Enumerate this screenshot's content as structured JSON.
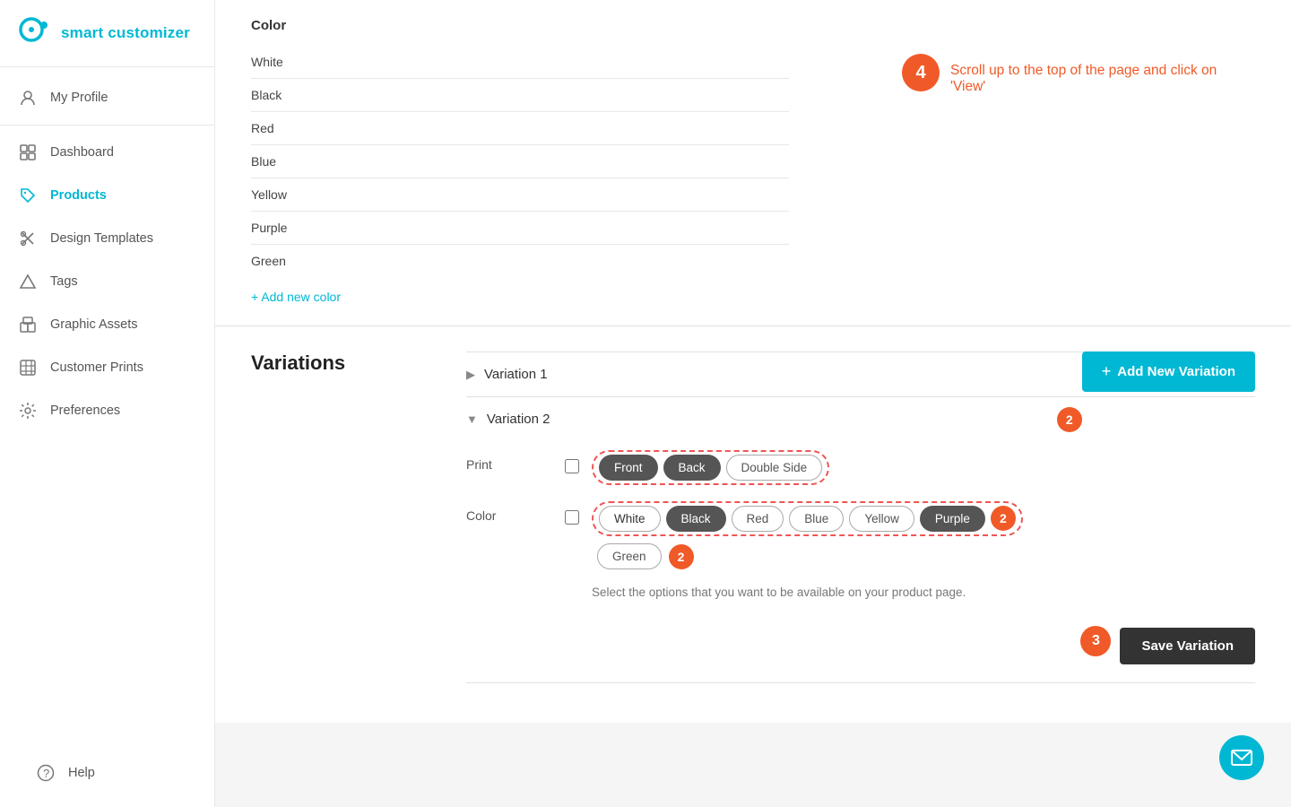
{
  "app": {
    "name": "smart customizer"
  },
  "sidebar": {
    "items": [
      {
        "id": "my-profile",
        "label": "My Profile",
        "icon": "person"
      },
      {
        "id": "dashboard",
        "label": "Dashboard",
        "icon": "grid"
      },
      {
        "id": "products",
        "label": "Products",
        "icon": "tag",
        "active": true
      },
      {
        "id": "design-templates",
        "label": "Design Templates",
        "icon": "scissors"
      },
      {
        "id": "tags",
        "label": "Tags",
        "icon": "triangle"
      },
      {
        "id": "graphic-assets",
        "label": "Graphic Assets",
        "icon": "boxes"
      },
      {
        "id": "customer-prints",
        "label": "Customer Prints",
        "icon": "grid2"
      },
      {
        "id": "preferences",
        "label": "Preferences",
        "icon": "gear"
      }
    ],
    "help": {
      "label": "Help"
    }
  },
  "color_section": {
    "title": "Color",
    "colors": [
      "White",
      "Black",
      "Red",
      "Blue",
      "Yellow",
      "Purple",
      "Green"
    ],
    "add_color_label": "+ Add new color"
  },
  "variations_section": {
    "title": "Variations",
    "add_button_label": "Add New Variation",
    "variations": [
      {
        "id": 1,
        "label": "Variation 1",
        "expanded": false
      },
      {
        "id": 2,
        "label": "Variation 2",
        "expanded": true,
        "fields": [
          {
            "id": "print",
            "label": "Print",
            "options": [
              "Front",
              "Back",
              "Double Side"
            ],
            "selected": [
              "Front",
              "Back"
            ]
          },
          {
            "id": "color",
            "label": "Color",
            "options": [
              "White",
              "Black",
              "Red",
              "Blue",
              "Yellow",
              "Purple",
              "Green"
            ],
            "selected": [
              "White",
              "Black",
              "Red",
              "Blue",
              "Yellow",
              "Purple",
              "Green"
            ]
          }
        ],
        "hint": "Select the options that you want to be available on your product page."
      }
    ],
    "save_button_label": "Save Variation"
  },
  "callout": {
    "step": "4",
    "text": "Scroll up to the top of the page and click on 'View'"
  },
  "step_badges": {
    "variation2": "2",
    "color_group": "2",
    "green_badge": "2",
    "save_step": "3"
  }
}
